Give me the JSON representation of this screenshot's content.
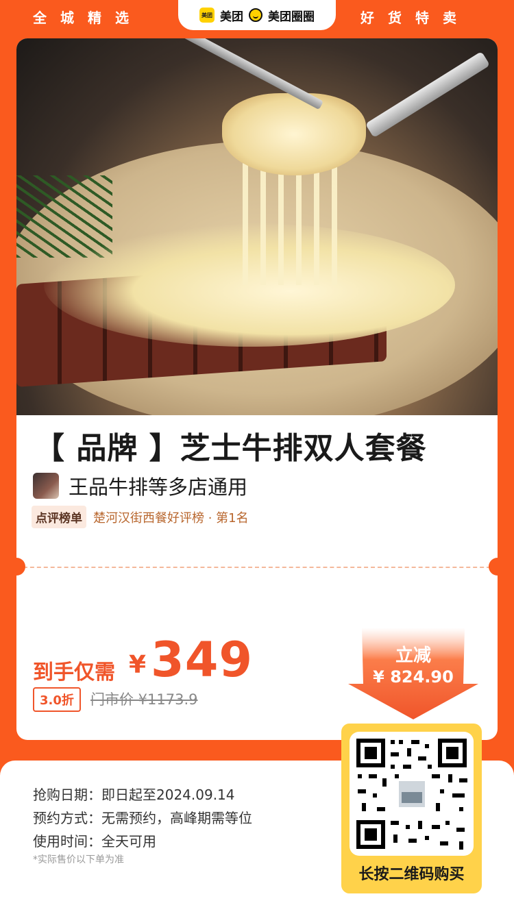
{
  "header": {
    "left_text": "全城精选",
    "right_text": "好货特卖",
    "brand_logo_text": "美团",
    "brand_one": "美团",
    "brand_two": "美团圈圈"
  },
  "product": {
    "title": "【 品牌 】芝士牛排双人套餐",
    "shop": "王品牛排等多店通用",
    "rank_badge": "点评榜单",
    "rank_text": "楚河汉街西餐好评榜 · 第1名"
  },
  "pricing": {
    "label": "到手仅需",
    "currency": "¥",
    "price": "349",
    "discount": "3.0折",
    "market_price": "门市价 ¥1173.9",
    "reduce_label": "立减",
    "reduce_value": "¥ 824.90"
  },
  "details": {
    "purchase_date_key": "抢购日期：",
    "purchase_date_val": "即日起至2024.09.14",
    "reservation_key": "预约方式：",
    "reservation_val": "无需预约，高峰期需等位",
    "usage_key": "使用时间：",
    "usage_val": "全天可用",
    "note": "*实际售价以下单为准"
  },
  "qr": {
    "label": "长按二维码购买"
  },
  "colors": {
    "brand_orange": "#fa5a1e",
    "price_red": "#f0552a",
    "qr_yellow": "#ffd24a"
  }
}
